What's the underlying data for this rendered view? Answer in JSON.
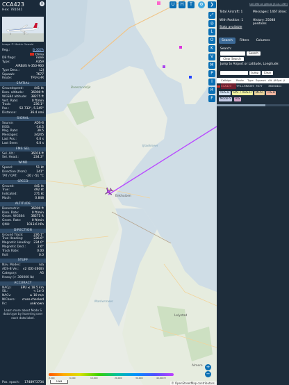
{
  "aircraft": {
    "callsign": "CCA423",
    "hex_label": "Hex:",
    "hex": "781641",
    "photo_credit": "Image © Martin Oswald",
    "reg_label": "Reg.:",
    "reg": "B-307A",
    "country": "China",
    "db_flags_label": "DB flags:",
    "db_flags": "none",
    "type_label": "Type:",
    "type": "A359",
    "type_desc": "AIRBUS A-350-900",
    "type_desc_label": "Type Desc.:",
    "type_desc_code": "L2J",
    "squawk_label": "Squawk:",
    "squawk": "7677",
    "route_label": "Route:",
    "route": "TFU-LHR"
  },
  "sections": {
    "spatial": "SPATIAL",
    "signal": "SIGNAL",
    "fms_sel": "FMS SEL",
    "wind": "WIND",
    "speed": "SPEED",
    "altitude": "ALTITUDE",
    "direction": "DIRECTION",
    "stuff": "STUFF",
    "accuracy": "ACCURACY"
  },
  "spatial": [
    {
      "k": "Groundspeed:",
      "v": "441 kt"
    },
    {
      "k": "Baro. altitude:",
      "v": "36000 ft"
    },
    {
      "k": "WGS84 altitude:",
      "v": "38275 ft"
    },
    {
      "k": "Vert. Rate:",
      "v": "0 ft/min"
    },
    {
      "k": "Track:",
      "v": "236.1°"
    },
    {
      "k": "Pos.:",
      "v": "52.732°, 5.245°"
    },
    {
      "k": "Distance:",
      "v": "36.4 nmi"
    }
  ],
  "signal": [
    {
      "k": "Source:",
      "v": "ADS-B"
    },
    {
      "k": "RSSI:",
      "v": "-16.5"
    },
    {
      "k": "Msg. Rate:",
      "v": "39.5"
    },
    {
      "k": "Messages:",
      "v": "34245"
    },
    {
      "k": "Last Pos.:",
      "v": "0.0 s"
    },
    {
      "k": "Last Seen:",
      "v": "0.0 s"
    }
  ],
  "fms_sel": [
    {
      "k": "Sel. Alt.:",
      "v": "36016 ft"
    },
    {
      "k": "Sel. Head.:",
      "v": "234.3°"
    }
  ],
  "wind": [
    {
      "k": "Speed:",
      "v": "51 kt"
    },
    {
      "k": "Direction (from):",
      "v": "241°"
    },
    {
      "k": "TAT / OAT:",
      "v": "-20 / -51 °C"
    }
  ],
  "speed": [
    {
      "k": "Ground:",
      "v": "441 kt"
    },
    {
      "k": "True:",
      "v": "492 kt"
    },
    {
      "k": "Indicated:",
      "v": "271 kt"
    },
    {
      "k": "Mach:",
      "v": "0.848"
    }
  ],
  "altitude": [
    {
      "k": "Barometric:",
      "v": "36000 ft"
    },
    {
      "k": "Baro. Rate:",
      "v": "0 ft/min"
    },
    {
      "k": "Geom. WGS84:",
      "v": "38275 ft"
    },
    {
      "k": "Geom. Rate:",
      "v": "0 ft/min"
    },
    {
      "k": "QNH:",
      "v": "1013.6 hPa"
    }
  ],
  "direction": [
    {
      "k": "Ground Track:",
      "v": "236.1°"
    },
    {
      "k": "True Heading:",
      "v": "236.6°"
    },
    {
      "k": "Magnetic Heading:",
      "v": "234.0°"
    },
    {
      "k": "Magnetic Decl.:",
      "v": "2.6°"
    },
    {
      "k": "Track Rate:",
      "v": "0.00"
    },
    {
      "k": "Roll:",
      "v": "0.0"
    }
  ],
  "stuff": [
    {
      "k": "Nav. Modes:",
      "v": "n/a"
    },
    {
      "k": "ADS-B Ver.:",
      "v": "v2 (DO-260B)"
    },
    {
      "k": "Category:",
      "v": "A5"
    },
    {
      "k": "Heavy (> 300000 lb)",
      "v": ""
    }
  ],
  "accuracy": [
    {
      "k": "NACp:",
      "v": "EPU ≤ 18.5 km"
    },
    {
      "k": "SIL:",
      "v": "< 1e-3"
    },
    {
      "k": "NACv:",
      "v": "≥ 10 m/s"
    },
    {
      "k": "NICbaro:",
      "v": "cross-checked"
    },
    {
      "k": "Rc:",
      "v": "unknown"
    }
  ],
  "learn_more": "Learn more about Mode S data type by hovering over each data label.",
  "pos_epoch": {
    "k": "Pos. epoch:",
    "v": "1748973734"
  },
  "map": {
    "buttons_top": [
      "U",
      "H",
      "T"
    ],
    "buttons_side": [
      "L",
      "O",
      "K",
      "V",
      "M",
      "P",
      "I",
      "R",
      "F"
    ],
    "labels": {
      "breezanddijk": "Breezanddijk",
      "ijsselmeer": "IJsselmeer",
      "markermeer": "Markermeer",
      "enkhuizen": "Enkhuizen",
      "lelystad": "Lelystad",
      "almere": "Almere"
    },
    "colorbar_ticks": [
      "2,000",
      "6,000",
      "10,000",
      "20,000",
      "30,000",
      "40,000 ft"
    ],
    "scale": "5 NM",
    "zoom_in": "+",
    "zoom_out": "−",
    "attribution": "© OpenStreetMap contributors."
  },
  "right": {
    "toplinks": "tar1090 on github (3.14.1789)",
    "total_aircraft": "Total Aircraft: 1",
    "with_position": "With Position: 1",
    "stats_available": "Stats available",
    "messages": "Messages: 1467.8/sec",
    "history": "History: 25088 positions",
    "tabs": [
      "Search",
      "Filters",
      "Columns"
    ],
    "search_label": "Search:",
    "search_button": "Search",
    "clear_search": "Clear Search",
    "jump_label": "Jump to Airport or Latitude, Longitude:",
    "jump_button": "Jump",
    "clear_button": "Clear",
    "table_headers": [
      "",
      "Callsign",
      "Route",
      "Type",
      "Squawk",
      "Alt. (ft)",
      "Spd. (kt)"
    ],
    "table_row": [
      "",
      "CCA423",
      "TFU-LHR",
      "A359",
      "7677",
      "36000",
      "441"
    ],
    "legend": [
      "ADS-B",
      "UAT / ADS-R",
      "MLAT",
      "TIS-B",
      "Mode-S",
      "AIS"
    ]
  },
  "colors": {
    "panel_bg": "#1a2a3a",
    "section_bg": "#304b66",
    "map_button": "#0a6fb4",
    "track": "#b94cff",
    "legend_adsb": "#d2e0ee",
    "legend_uat": "#f0f0a0",
    "legend_mlat": "#e8d29a",
    "legend_tisb": "#f3b7a0",
    "legend_modes": "#c5cce8",
    "legend_ais": "#d7a7c9"
  }
}
